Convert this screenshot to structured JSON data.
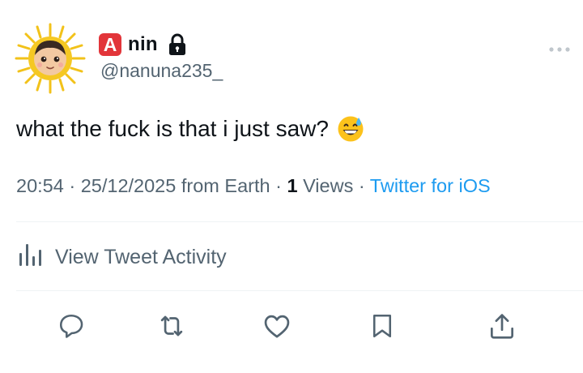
{
  "author": {
    "badge_letter": "A",
    "name": "nin",
    "handle": "@nanuna235_",
    "avatar_icon": "sun-face-avatar",
    "lock_icon": "lock-icon"
  },
  "tweet": {
    "text": "what the fuck is that i just saw?",
    "emoji_icon": "grinning-face-with-sweat-emoji"
  },
  "meta": {
    "time": "20:54",
    "date": "25/12/2025",
    "location": "from Earth",
    "views_count": "1",
    "views_label": "Views",
    "source": "Twitter for iOS",
    "separator": "·"
  },
  "activity": {
    "label": "View Tweet Activity"
  },
  "actions": [
    "reply-icon",
    "retweet-icon",
    "like-icon",
    "bookmark-icon",
    "share-icon"
  ],
  "colors": {
    "text_primary": "#0f1419",
    "text_secondary": "#536471",
    "link": "#1d9bf0",
    "badge_red": "#e2353a",
    "divider": "#eff3f4"
  }
}
